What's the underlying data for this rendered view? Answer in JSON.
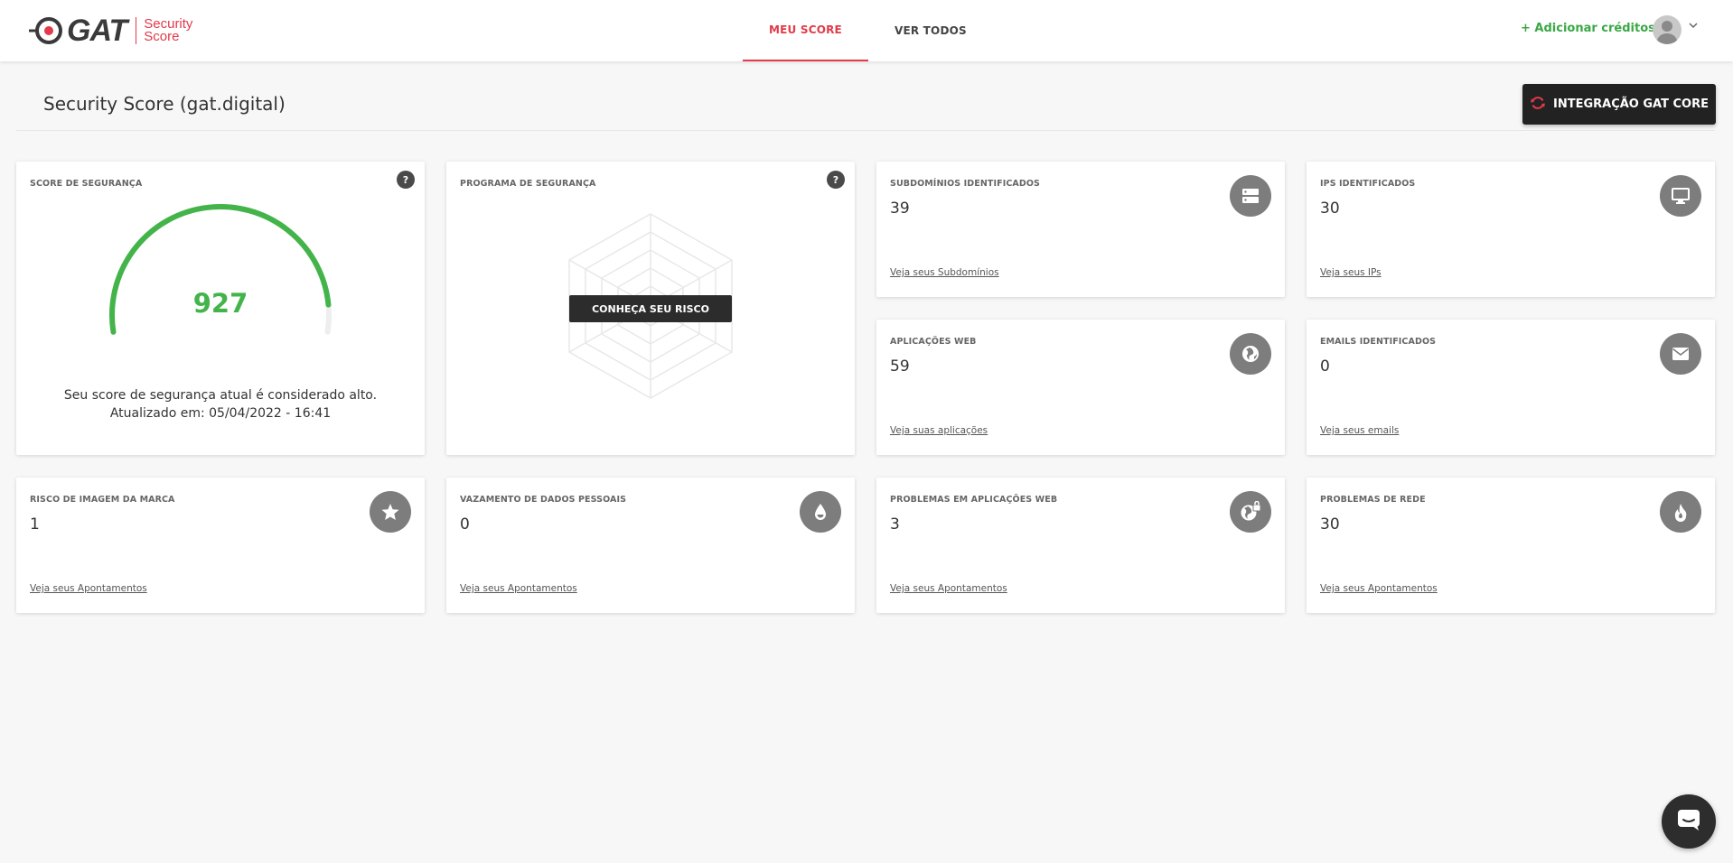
{
  "header": {
    "logo_text": "GAT",
    "logo_sub_1": "Security",
    "logo_sub_2": "Score",
    "tabs": [
      {
        "label": "MEU SCORE",
        "active": true
      },
      {
        "label": "VER TODOS",
        "active": false
      }
    ],
    "add_credits": "+ Adicionar créditos"
  },
  "page": {
    "title": "Security Score (gat.digital)",
    "integration_button": "INTEGRAÇÃO GAT CORE"
  },
  "score_card": {
    "label": "SCORE DE SEGURANÇA",
    "value": "927",
    "score": 927,
    "score_max": 1000,
    "description": "Seu score de segurança atual é considerado alto.",
    "updated": "Atualizado em: 05/04/2022 - 16:41",
    "help": "?"
  },
  "program_card": {
    "label": "PROGRAMA DE SEGURANÇA",
    "button": "CONHEÇA SEU RISCO",
    "help": "?"
  },
  "stat_cards": [
    {
      "label": "SUBDOMÍNIOS IDENTIFICADOS",
      "value": "39",
      "link": "Veja seus Subdomínios",
      "icon": "server-icon"
    },
    {
      "label": "IPS IDENTIFICADOS",
      "value": "30",
      "link": "Veja seus IPs",
      "icon": "monitor-icon"
    },
    {
      "label": "APLICAÇÕES WEB",
      "value": "59",
      "link": "Veja suas aplicações",
      "icon": "globe-icon"
    },
    {
      "label": "EMAILS IDENTIFICADOS",
      "value": "0",
      "link": "Veja seus emails",
      "icon": "mail-icon"
    },
    {
      "label": "RISCO DE IMAGEM DA MARCA",
      "value": "1",
      "link": "Veja seus Apontamentos",
      "icon": "star-icon"
    },
    {
      "label": "VAZAMENTO DE DADOS PESSOAIS",
      "value": "0",
      "link": "Veja seus Apontamentos",
      "icon": "drop-icon"
    },
    {
      "label": "PROBLEMAS EM APLICAÇÕES WEB",
      "value": "3",
      "link": "Veja seus Apontamentos",
      "icon": "globe-lock-icon"
    },
    {
      "label": "PROBLEMAS DE REDE",
      "value": "30",
      "link": "Veja seus Apontamentos",
      "icon": "fire-icon"
    }
  ],
  "colors": {
    "accent": "#e23a4a",
    "success": "#43b44a",
    "icon_bg": "#7d7d7d"
  }
}
